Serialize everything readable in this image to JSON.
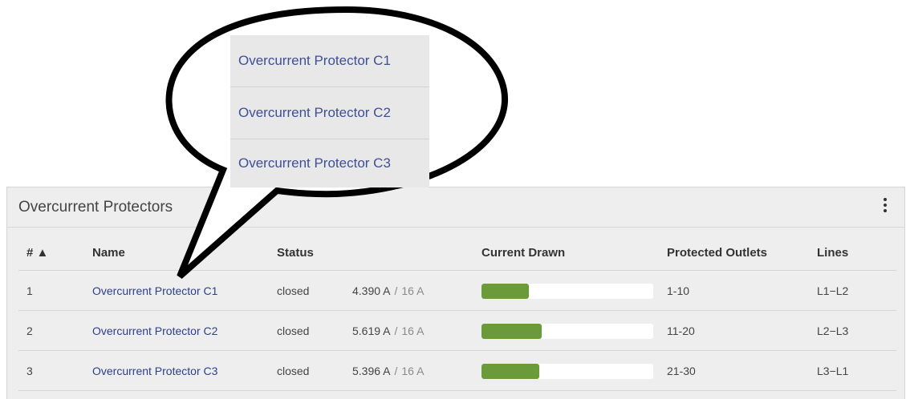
{
  "panel": {
    "title": "Overcurrent Protectors"
  },
  "table": {
    "headers": {
      "num": "# ▲",
      "name": "Name",
      "status": "Status",
      "current": "Current Drawn",
      "outlets": "Protected Outlets",
      "lines": "Lines"
    },
    "reading_separator": "/",
    "rows": [
      {
        "num": "1",
        "name": "Overcurrent Protector C1",
        "status": "closed",
        "current": "4.390 A",
        "max": "16 A",
        "usage_fraction": 0.274,
        "outlets": "1-10",
        "lines": "L1−L2"
      },
      {
        "num": "2",
        "name": "Overcurrent Protector C2",
        "status": "closed",
        "current": "5.619 A",
        "max": "16 A",
        "usage_fraction": 0.351,
        "outlets": "11-20",
        "lines": "L2−L3"
      },
      {
        "num": "3",
        "name": "Overcurrent Protector C3",
        "status": "closed",
        "current": "5.396 A",
        "max": "16 A",
        "usage_fraction": 0.337,
        "outlets": "21-30",
        "lines": "L3−L1"
      }
    ]
  },
  "callout": {
    "items": [
      "Overcurrent Protector C1",
      "Overcurrent Protector C2",
      "Overcurrent Protector C3"
    ]
  },
  "colors": {
    "bar_fill": "#6a9a3a",
    "link": "#2b3f8e",
    "panel_bg": "#eeeeee"
  },
  "icons": {
    "menu": "kebab-menu-icon",
    "sort": "sort-ascending-icon"
  }
}
